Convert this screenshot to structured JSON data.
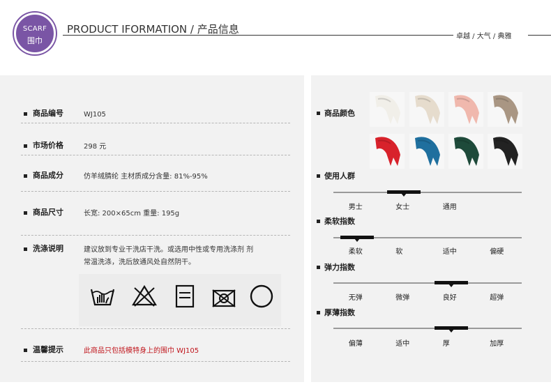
{
  "header": {
    "badge_en": "SCARF",
    "badge_cn": "围巾",
    "title": "PRODUCT IFORMATION / 产品信息",
    "tagline": "卓越 / 大气 / 典雅"
  },
  "product": {
    "code": {
      "label": "商品编号",
      "value": "WJ105"
    },
    "price": {
      "label": "市场价格",
      "value": "298 元"
    },
    "material": {
      "label": "商品成分",
      "value": "仿羊绒腈纶  主材质成分含量: 81%-95%"
    },
    "size": {
      "label": "商品尺寸",
      "value": "长宽: 200×65cm   重量: 195g"
    },
    "wash": {
      "label": "洗涤说明",
      "line1": "建议放到专业干洗店干洗。或选用中性或专用洗涤剂  剂",
      "line2": "常温洗涤，洗后放通风处自然阴干。"
    },
    "tip": {
      "label": "温馨提示",
      "value": "此商品只包括模特身上的围巾 WJ105"
    }
  },
  "care_icons": [
    "hand-wash-icon",
    "no-bleach-icon",
    "line-dry-icon",
    "no-tumble-dry-icon",
    "dry-clean-icon"
  ],
  "colors": {
    "label": "商品颜色",
    "swatches": [
      "#f1efe9",
      "#e6dccd",
      "#f0b8ad",
      "#a99683",
      "#d8222b",
      "#1f6f9e",
      "#1e4a3a",
      "#222222"
    ]
  },
  "scales": [
    {
      "label": "使用人群",
      "options": [
        "男士",
        "女士",
        "通用"
      ],
      "selected": 1
    },
    {
      "label": "柔软指数",
      "options": [
        "柔软",
        "软",
        "适中",
        "偏硬"
      ],
      "selected": 0
    },
    {
      "label": "弹力指数",
      "options": [
        "无弹",
        "微弹",
        "良好",
        "超弹"
      ],
      "selected": 2
    },
    {
      "label": "厚薄指数",
      "options": [
        "偏薄",
        "适中",
        "厚",
        "加厚"
      ],
      "selected": 2
    }
  ]
}
